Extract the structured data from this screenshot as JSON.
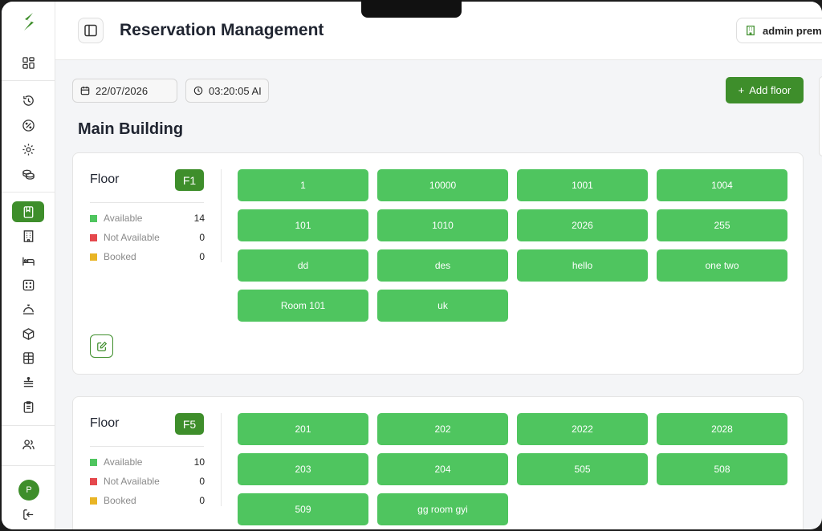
{
  "header": {
    "title": "Reservation Management",
    "user_label": "admin premi"
  },
  "toolbar": {
    "date": "22/07/2026",
    "time": "03:20:05 AI",
    "add_floor_label": "Add floor",
    "add_floor_prefix": "+"
  },
  "building": {
    "name": "Main Building"
  },
  "sidebar": {
    "avatar_initial": "P"
  },
  "floors": [
    {
      "label": "Floor",
      "code": "F1",
      "stats": [
        {
          "label": "Available",
          "count": "14"
        },
        {
          "label": "Not Available",
          "count": "0"
        },
        {
          "label": "Booked",
          "count": "0"
        }
      ],
      "rooms": [
        "1",
        "10000",
        "1001",
        "1004",
        "101",
        "1010",
        "2026",
        "255",
        "dd",
        "des",
        "hello",
        "one two",
        "Room 101",
        "uk"
      ]
    },
    {
      "label": "Floor",
      "code": "F5",
      "stats": [
        {
          "label": "Available",
          "count": "10"
        },
        {
          "label": "Not Available",
          "count": "0"
        },
        {
          "label": "Booked",
          "count": "0"
        }
      ],
      "rooms": [
        "201",
        "202",
        "2022",
        "2028",
        "203",
        "204",
        "505",
        "508",
        "509",
        "gg room gyi"
      ]
    }
  ],
  "colors": {
    "brand_green": "#3e8e2b",
    "room_available": "#4fc55f",
    "status_available": "#4fc55f",
    "status_not_available": "#e5484d",
    "status_booked": "#e9b526"
  }
}
